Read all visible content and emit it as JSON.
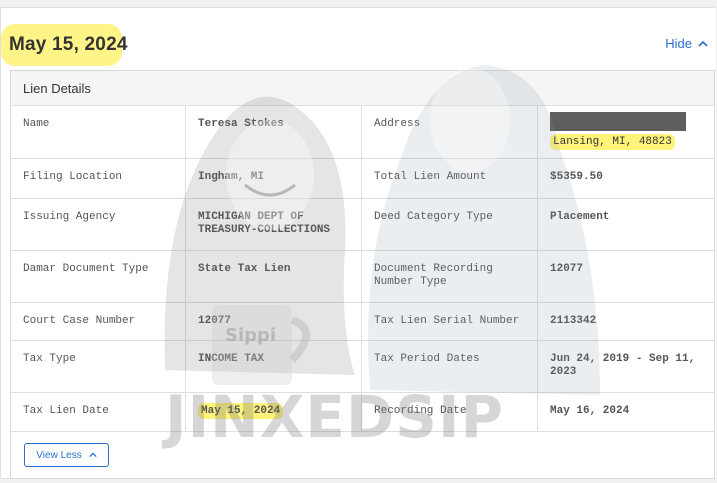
{
  "header": {
    "date": "May 15, 2024",
    "hide_label": "Hide"
  },
  "details": {
    "title": "Lien Details",
    "rows": [
      {
        "l1": "Name",
        "v1": "Teresa Stokes",
        "l2": "Address",
        "v2": "Lansing, MI, 48823"
      },
      {
        "l1": "Filing Location",
        "v1": "Ingham, MI",
        "l2": "Total Lien Amount",
        "v2": "$5359.50"
      },
      {
        "l1": "Issuing Agency",
        "v1": "MICHIGAN DEPT OF TREASURY-COLLECTIONS",
        "l2": "Deed Category Type",
        "v2": "Placement"
      },
      {
        "l1": "Damar Document Type",
        "v1": "State Tax Lien",
        "l2": "Document Recording Number Type",
        "v2": "12077"
      },
      {
        "l1": "Court Case Number",
        "v1": "12077",
        "l2": "Tax Lien Serial Number",
        "v2": "2113342"
      },
      {
        "l1": "Tax Type",
        "v1": "INCOME TAX",
        "l2": "Tax Period Dates",
        "v2": "Jun 24, 2019 - Sep 11, 2023"
      },
      {
        "l1": "Tax Lien Date",
        "v1": "May 15, 2024",
        "l2": "Recording Date",
        "v2": "May 16, 2024"
      }
    ],
    "view_less_label": "View Less"
  },
  "watermark": {
    "text": "JINXEDSIP",
    "mug_text": "Sippi"
  },
  "colors": {
    "accent": "#2a6fd1",
    "highlight": "#fff37a",
    "redaction": "#5e5e5e"
  }
}
